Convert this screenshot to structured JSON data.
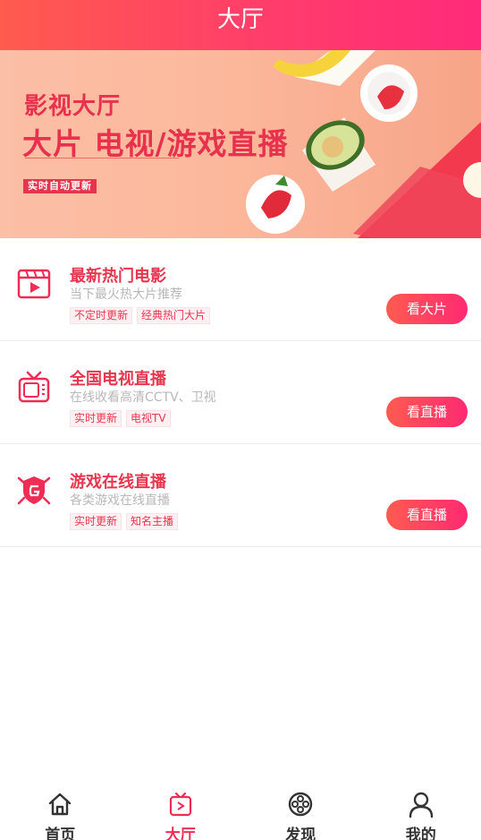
{
  "header": {
    "title": "大厅"
  },
  "banner": {
    "subtitle": "影视大厅",
    "headline": "大片 电视/游戏直播",
    "tag": "实时自动更新"
  },
  "items": [
    {
      "title": "最新热门电影",
      "desc": "当下最火热大片推荐",
      "tags": [
        "不定时更新",
        "经典热门大片"
      ],
      "button": "看大片",
      "icon": "movie-clapper-icon"
    },
    {
      "title": "全国电视直播",
      "desc": "在线收看高清CCTV、卫视",
      "tags": [
        "实时更新",
        "电视TV"
      ],
      "button": "看直播",
      "icon": "tv-icon"
    },
    {
      "title": "游戏在线直播",
      "desc": "各类游戏在线直播",
      "tags": [
        "实时更新",
        "知名主播"
      ],
      "button": "看直播",
      "icon": "game-shield-icon"
    }
  ],
  "tabs": [
    {
      "label": "首页",
      "icon": "home-icon",
      "active": false
    },
    {
      "label": "大厅",
      "icon": "tv-play-icon",
      "active": true
    },
    {
      "label": "发现",
      "icon": "film-reel-icon",
      "active": false
    },
    {
      "label": "我的",
      "icon": "user-icon",
      "active": false
    }
  ],
  "colors": {
    "accent": "#ee2d55",
    "header_start": "#ff5b4e",
    "header_end": "#ff2a7a"
  }
}
